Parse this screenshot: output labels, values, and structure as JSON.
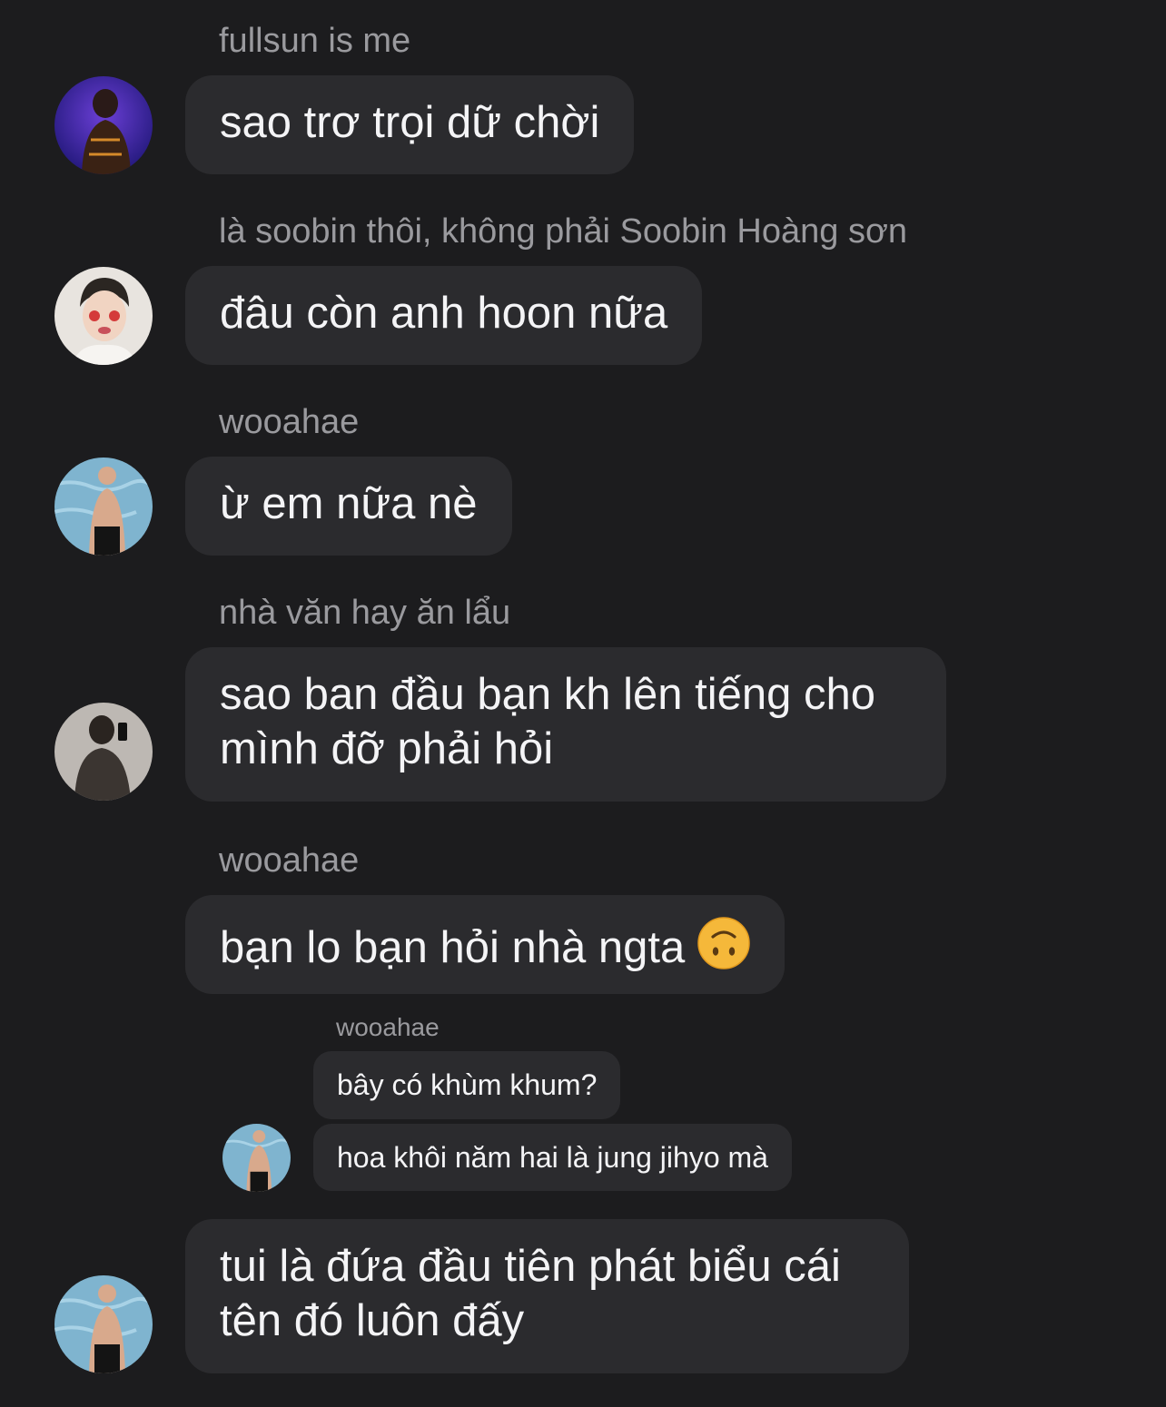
{
  "messages": [
    {
      "sender": "fullsun is me",
      "text": "sao trơ trọi dữ chời",
      "avatar": "concert-performer-avatar"
    },
    {
      "sender": "là soobin thôi, không phải Soobin Hoàng sơn",
      "text": "đâu còn anh hoon nữa",
      "avatar": "face-paint-avatar"
    },
    {
      "sender": "wooahae",
      "text": "ừ em nữa nè",
      "avatar": "pool-swimmer-avatar"
    },
    {
      "sender": "nhà văn hay ăn lẩu",
      "text_lines": [
        "sao ban đầu bạn kh lên tiếng cho",
        "mình đỡ phải hỏi"
      ],
      "avatar": "phone-selfie-avatar"
    },
    {
      "sender": "wooahae",
      "text": "bạn lo bạn hỏi nhà ngta",
      "emoji": "upside-down-face"
    },
    {
      "sender": "wooahae",
      "quoted": true,
      "texts": [
        "bây có khùm khum?",
        "hoa khôi năm hai là jung jihyo mà"
      ],
      "avatar": "pool-swimmer-avatar"
    },
    {
      "text_lines": [
        "tui là đứa đầu tiên phát biểu cái",
        "tên đó luôn đấy"
      ],
      "avatar": "pool-swimmer-avatar"
    }
  ],
  "colors": {
    "background": "#1c1c1e",
    "bubble": "#2b2b2e",
    "sender_name": "#9a9a9e",
    "message_text": "#f4f4f6"
  }
}
